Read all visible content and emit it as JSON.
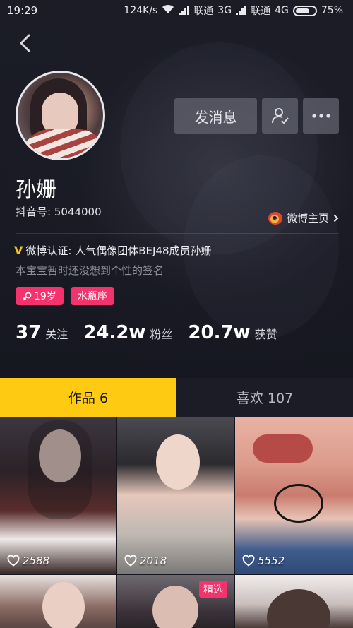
{
  "status_bar": {
    "time": "19:29",
    "network_speed": "124K/s",
    "carrier1": "联通",
    "net1": "3G",
    "carrier2": "联通",
    "net2": "4G",
    "battery": "75%",
    "battery_level": 0.75
  },
  "profile": {
    "name": "孙姗",
    "douyin_id": "抖音号: 5044000",
    "weibo_link": "微博主页",
    "verify_mark": "V",
    "verify_text": "微博认证: 人气偶像团体BEJ48成员孙姗",
    "signature": "本宝宝暂时还没想到个性的签名",
    "tags": [
      "19岁",
      "水瓶座"
    ],
    "send_message": "发消息"
  },
  "stats": [
    {
      "value": "37",
      "label": "关注"
    },
    {
      "value": "24.2w",
      "label": "粉丝"
    },
    {
      "value": "20.7w",
      "label": "获赞"
    }
  ],
  "tabs": [
    {
      "label": "作品 6",
      "active": true
    },
    {
      "label": "喜欢 107",
      "active": false
    }
  ],
  "videos": [
    {
      "likes": "2588",
      "featured": false
    },
    {
      "likes": "2018",
      "featured": false
    },
    {
      "likes": "5552",
      "featured": false
    },
    {
      "likes": "",
      "featured": false
    },
    {
      "likes": "",
      "featured": true,
      "badge": "精选"
    },
    {
      "likes": "",
      "featured": false
    }
  ],
  "colors": {
    "accent_yellow": "#fecb12",
    "tag_pink": "#f5326c",
    "background": "#15161f"
  }
}
